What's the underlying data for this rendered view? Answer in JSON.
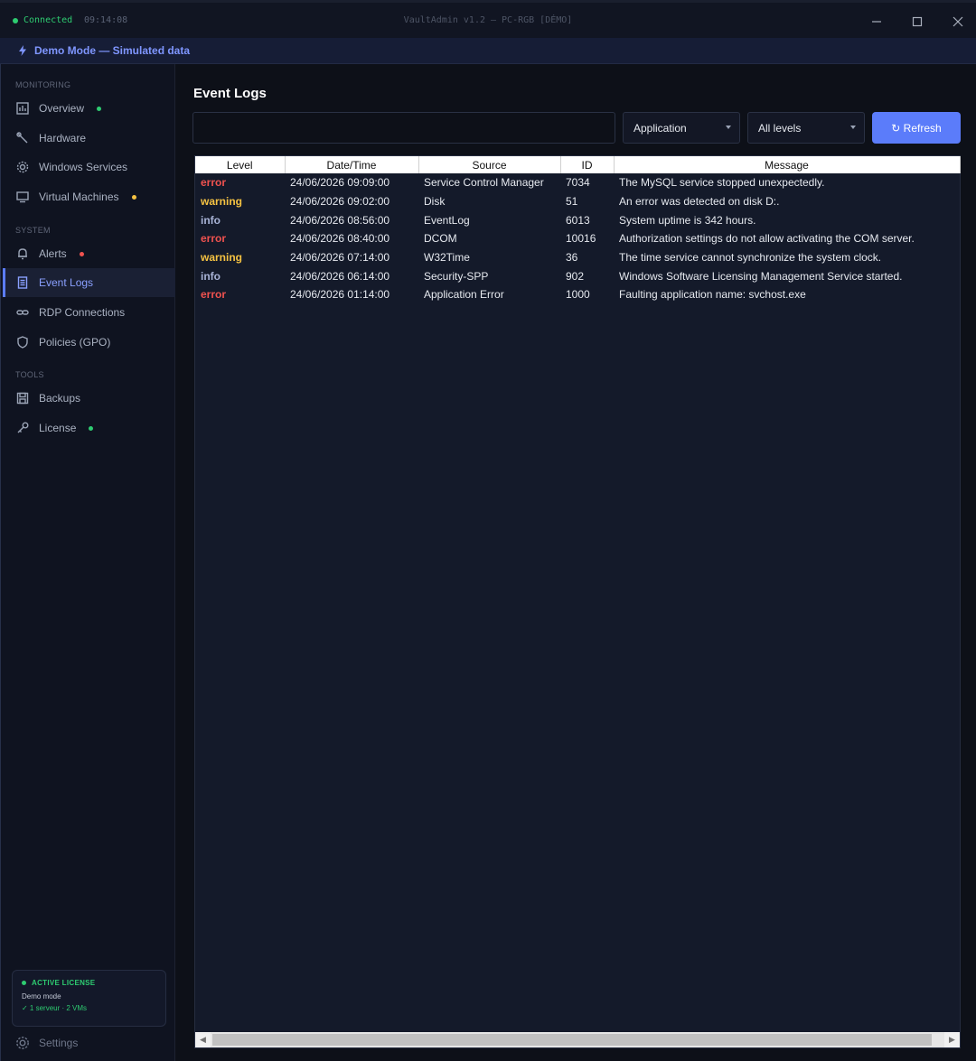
{
  "titlebar": {
    "status": "Connected",
    "time": "09:14:08",
    "title": "VaultAdmin v1.2 — PC-RGB [DÉMO]"
  },
  "banner": {
    "text": "Demo Mode — Simulated data"
  },
  "sidebar": {
    "sections": [
      {
        "label": "MONITORING"
      },
      {
        "label": "SYSTEM"
      },
      {
        "label": "TOOLS"
      }
    ],
    "items": [
      {
        "label": "Overview",
        "icon": "bar-chart-icon",
        "indicator": "#2ecc71"
      },
      {
        "label": "Hardware",
        "icon": "wrench-icon",
        "indicator": null
      },
      {
        "label": "Windows Services",
        "icon": "gear-icon",
        "indicator": null
      },
      {
        "label": "Virtual Machines",
        "icon": "monitor-icon",
        "indicator": "#f5c242"
      },
      {
        "label": "Alerts",
        "icon": "bell-icon",
        "indicator": "#f0524f"
      },
      {
        "label": "Event Logs",
        "icon": "document-icon",
        "indicator": null,
        "active": true
      },
      {
        "label": "RDP Connections",
        "icon": "link-icon",
        "indicator": null
      },
      {
        "label": "Policies (GPO)",
        "icon": "shield-icon",
        "indicator": null
      },
      {
        "label": "Backups",
        "icon": "save-icon",
        "indicator": null
      },
      {
        "label": "License",
        "icon": "key-icon",
        "indicator": "#2ecc71"
      }
    ],
    "license_card": {
      "title": "ACTIVE LICENSE",
      "mode": "Demo mode",
      "plan": "✓ 1 serveur · 2 VMs"
    },
    "settings_label": "Settings"
  },
  "main": {
    "title": "Event Logs",
    "search_value": "",
    "log_select": "Application",
    "level_select": "All levels",
    "refresh_label": "↻ Refresh",
    "table": {
      "columns": [
        "Level",
        "Date/Time",
        "Source",
        "ID",
        "Message"
      ],
      "rows": [
        {
          "level": "error",
          "datetime": "24/06/2026 09:09:00",
          "source": "Service Control Manager",
          "id": "7034",
          "message": "The MySQL service stopped unexpectedly."
        },
        {
          "level": "warning",
          "datetime": "24/06/2026 09:02:00",
          "source": "Disk",
          "id": "51",
          "message": "An error was detected on disk D:."
        },
        {
          "level": "info",
          "datetime": "24/06/2026 08:56:00",
          "source": "EventLog",
          "id": "6013",
          "message": "System uptime is 342 hours."
        },
        {
          "level": "error",
          "datetime": "24/06/2026 08:40:00",
          "source": "DCOM",
          "id": "10016",
          "message": "Authorization settings do not allow activating the COM server."
        },
        {
          "level": "warning",
          "datetime": "24/06/2026 07:14:00",
          "source": "W32Time",
          "id": "36",
          "message": "The time service cannot synchronize the system clock."
        },
        {
          "level": "info",
          "datetime": "24/06/2026 06:14:00",
          "source": "Security-SPP",
          "id": "902",
          "message": "Windows Software Licensing Management Service started."
        },
        {
          "level": "error",
          "datetime": "24/06/2026 01:14:00",
          "source": "Application Error",
          "id": "1000",
          "message": "Faulting application name: svchost.exe"
        }
      ]
    }
  }
}
